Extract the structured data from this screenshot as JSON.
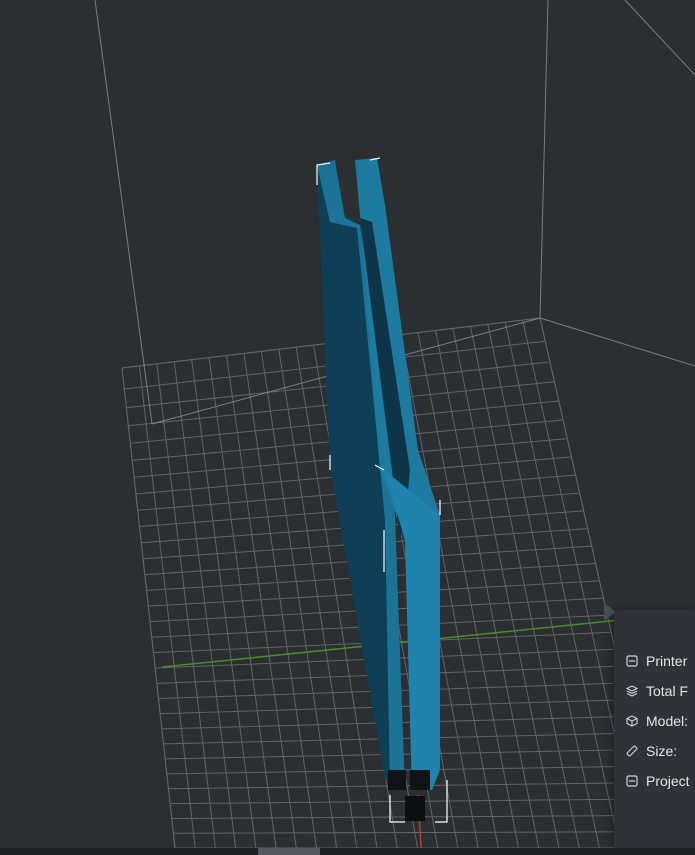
{
  "viewport": {
    "background": "#2c2f32",
    "grid_color": "#8a9199",
    "model_color": "#1e7396",
    "model_shadow_color": "#0e3e55",
    "x_axis_color": "#4a8a2a",
    "y_axis_color": "#c0392b"
  },
  "info_panel": {
    "rows": [
      {
        "icon": "printer-icon",
        "label": "Printer"
      },
      {
        "icon": "layers-icon",
        "label": "Total F"
      },
      {
        "icon": "cube-icon",
        "label": "Model:"
      },
      {
        "icon": "ruler-icon",
        "label": "Size:"
      },
      {
        "icon": "project-icon",
        "label": "Project"
      }
    ]
  }
}
